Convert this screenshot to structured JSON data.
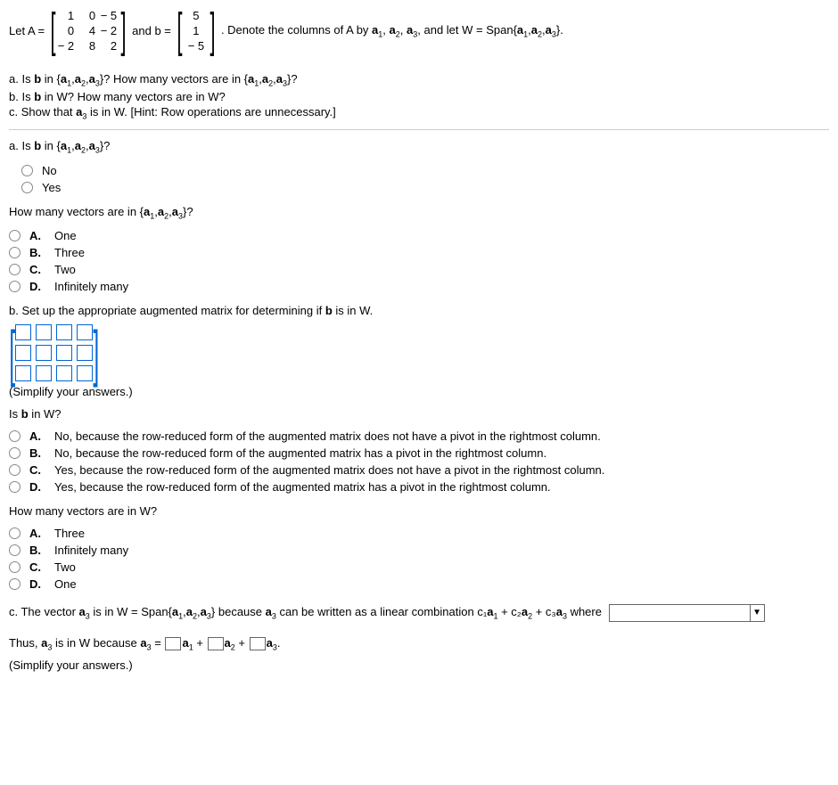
{
  "preamble": {
    "let_a": "Let A =",
    "A": {
      "r1": [
        "1",
        "0",
        "− 5"
      ],
      "r2": [
        "0",
        "4",
        "− 2"
      ],
      "r3": [
        "− 2",
        "8",
        "2"
      ]
    },
    "and_b": "and b =",
    "b": {
      "r1": "5",
      "r2": "1",
      "r3": "− 5"
    },
    "after": ". Denote the columns of A by "
  },
  "subs": {
    "a1": "a",
    "s1": "1",
    "a2": "a",
    "s2": "2",
    "a3": "a",
    "s3": "3",
    "span": ", and let W = Span{",
    "close": "}."
  },
  "questions": {
    "a": "a. Is b in {a₁,a₂,a₃}? How many vectors are in {a₁,a₂,a₃}?",
    "b": "b. Is b in W? How many vectors are in W?",
    "c": "c. Show that a₃ is in W. [Hint: Row operations are unnecessary.]"
  },
  "qa": {
    "label": "a. Is b in {a₁,a₂,a₃}?",
    "options": [
      "No",
      "Yes"
    ]
  },
  "qa2": {
    "label": "How many vectors are in {a₁,a₂,a₃}?",
    "options": [
      {
        "letter": "A.",
        "text": "One"
      },
      {
        "letter": "B.",
        "text": "Three"
      },
      {
        "letter": "C.",
        "text": "Two"
      },
      {
        "letter": "D.",
        "text": "Infinitely many"
      }
    ]
  },
  "qb": {
    "label": "b. Set up the appropriate augmented matrix for determining if b is in W.",
    "hint": "(Simplify your answers.)"
  },
  "qb2": {
    "label": "Is b in W?",
    "options": [
      {
        "letter": "A.",
        "text": "No, because the row-reduced form of the augmented matrix does not have a pivot in the rightmost column."
      },
      {
        "letter": "B.",
        "text": "No, because the row-reduced form of the augmented matrix has a pivot in the rightmost column."
      },
      {
        "letter": "C.",
        "text": "Yes, because the row-reduced form of the augmented matrix does not have a pivot in the rightmost column."
      },
      {
        "letter": "D.",
        "text": "Yes, because the row-reduced form of the augmented matrix has a pivot in the rightmost column."
      }
    ]
  },
  "qb3": {
    "label": "How many vectors are in W?",
    "options": [
      {
        "letter": "A.",
        "text": "Three"
      },
      {
        "letter": "B.",
        "text": "Infinitely many"
      },
      {
        "letter": "C.",
        "text": "Two"
      },
      {
        "letter": "D.",
        "text": "One"
      }
    ]
  },
  "qc": {
    "prefix": "c. The vector ",
    "a3": "a₃",
    "mid1": " is in W = Span{",
    "set": "a₁,a₂,a₃",
    "mid2": "} because ",
    "mid3": " can be written as a linear combination c₁",
    "a1b": "a₁",
    "plus": " + c₂",
    "a2b": "a₂",
    "plus2": " + c₃",
    "a3b": "a₃",
    "where": " where"
  },
  "qc2": {
    "prefix": "Thus, ",
    "a3": "a₃",
    "mid": " is in W because ",
    "eq": " = ",
    "a1": "a₁",
    "plus": " + ",
    "a2": "a₂",
    "a3b": "a₃",
    "dot": ".",
    "hint": "(Simplify your answers.)"
  }
}
